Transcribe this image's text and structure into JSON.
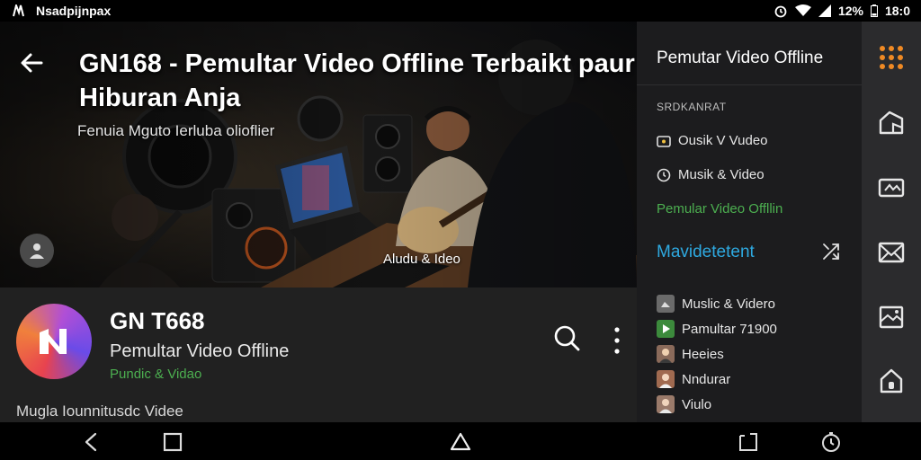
{
  "status_bar": {
    "app_label": "Nsadpijnpax",
    "battery": "12%",
    "time": "18:0"
  },
  "hero": {
    "title": "GN168 - Pemultar Video Offline Terbaikt paur Hiburan Anja",
    "subtitle": "Fenuia Mguto Ierluba olioflier",
    "caption": "Aludu & Ideo"
  },
  "channel": {
    "name": "GN T668",
    "description": "Pemultar Video Offline",
    "category": "Pundic & Vidao",
    "footer": "Mugla Iounnitusdc Videe"
  },
  "panel": {
    "title": "Pemutar Video Offline",
    "section_label": "SRDKANRAT",
    "items": [
      {
        "label": "Ousik V Vudeo",
        "icon": "tv-icon"
      },
      {
        "label": "Musik & Video",
        "icon": "clock-icon"
      },
      {
        "label": "Pemular Video Offllin",
        "icon": "none"
      }
    ],
    "subheader": "Mavidetetent",
    "media_items": [
      {
        "label": "Muslic & Videro",
        "color": "#6a6a6a"
      },
      {
        "label": "Pamultar 71900",
        "color": "#3c8a3c"
      },
      {
        "label": "Heeies",
        "color": "#8a6a5a"
      },
      {
        "label": "Nndurar",
        "color": "#a06a50"
      },
      {
        "label": "Viulo",
        "color": "#9a7a6a"
      }
    ]
  },
  "colors": {
    "accent_green": "#4caf50",
    "accent_blue": "#2ea9e0",
    "grid_orange": "#f08a24"
  }
}
